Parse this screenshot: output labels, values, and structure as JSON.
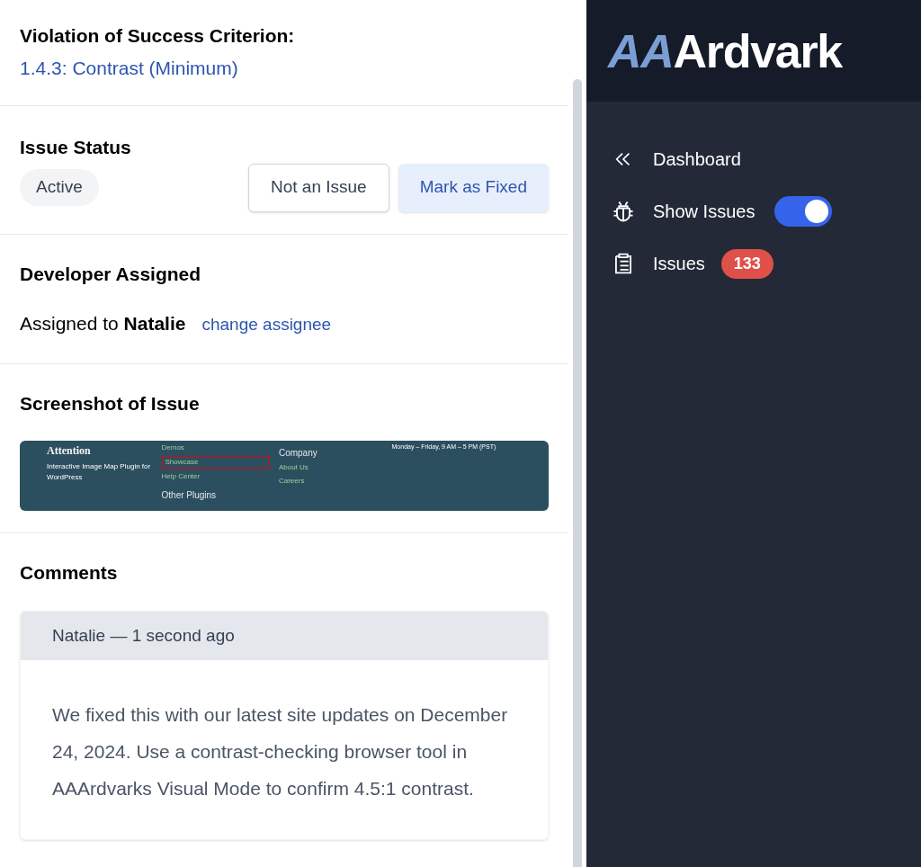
{
  "criterion": {
    "heading": "Violation of Success Criterion:",
    "link": "1.4.3: Contrast (Minimum)"
  },
  "status": {
    "heading": "Issue Status",
    "badge": "Active",
    "buttons": [
      {
        "label": "Not an Issue",
        "kind": "outline"
      },
      {
        "label": "Mark as Fixed",
        "kind": "primary"
      }
    ]
  },
  "developer": {
    "heading": "Developer Assigned",
    "prefix": "Assigned to",
    "name": "Natalie",
    "link": "change assignee"
  },
  "screenshot": {
    "heading": "Screenshot of Issue",
    "columns": [
      {
        "items": [
          {
            "text": "Attention",
            "kind": "title"
          },
          {
            "text": "Interactive Image Map Plugin for WordPress",
            "kind": "text"
          }
        ]
      },
      {
        "items": [
          {
            "text": "Demos",
            "kind": "link"
          },
          {
            "text": "Showcase",
            "kind": "highlight"
          },
          {
            "text": "Help Center",
            "kind": "link"
          },
          {
            "text": "Other Plugins",
            "kind": "heading"
          }
        ]
      },
      {
        "items": [
          {
            "text": "Company",
            "kind": "heading"
          },
          {
            "text": "About Us",
            "kind": "link"
          },
          {
            "text": "Careers",
            "kind": "link"
          }
        ]
      },
      {
        "items": [
          {
            "text": "Monday – Friday, 9 AM – 5 PM (PST)",
            "kind": "small"
          }
        ]
      }
    ]
  },
  "comments": {
    "heading": "Comments",
    "items": [
      {
        "author": "Natalie — 1 second ago",
        "body": "We fixed this with our latest site updates on December 24, 2024. Use a contrast-checking browser tool in AAArdvarks Visual Mode to confirm 4.5:1 contrast."
      }
    ]
  },
  "sidebar": {
    "logo": {
      "prefix": "AA",
      "word": "Ardvark"
    },
    "items": [
      {
        "kind": "back",
        "label": "Dashboard"
      },
      {
        "kind": "toggle",
        "label": "Show Issues",
        "on": true
      },
      {
        "kind": "count",
        "label": "Issues",
        "badge": "133"
      }
    ]
  }
}
